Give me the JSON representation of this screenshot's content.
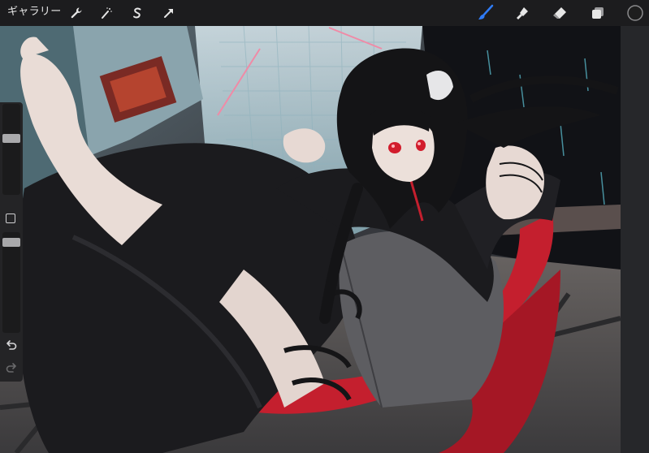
{
  "toolbar": {
    "gallery_label": "ギャラリー",
    "tools_left": [
      {
        "name": "actions",
        "icon": "wrench-icon"
      },
      {
        "name": "adjustments",
        "icon": "magic-wand-icon"
      },
      {
        "name": "selection",
        "icon": "selection-s-icon"
      },
      {
        "name": "transform",
        "icon": "arrow-cursor-icon"
      }
    ],
    "tools_right": [
      {
        "name": "brush",
        "icon": "brush-icon",
        "active": true
      },
      {
        "name": "smudge",
        "icon": "smudge-icon"
      },
      {
        "name": "eraser",
        "icon": "eraser-icon"
      },
      {
        "name": "layers",
        "icon": "layers-icon"
      },
      {
        "name": "color",
        "icon": "color-circle-icon"
      }
    ],
    "accent_color": "#2f7bf6",
    "active_color": "#1e1e1e"
  },
  "sidebar": {
    "brush_size_level": 0.37,
    "opacity_level": 0.06,
    "modify_button_icon": "square-icon",
    "undo_icon": "undo-icon",
    "redo_icon": "redo-icon"
  },
  "canvas": {
    "artwork": "illustration",
    "palette": {
      "hair": "#141416",
      "coat": "#1a1a1c",
      "scarf": "#c41f2e",
      "skin": "#e9dcd6",
      "eye": "#d21c2c",
      "background": "#3a3d42"
    }
  }
}
